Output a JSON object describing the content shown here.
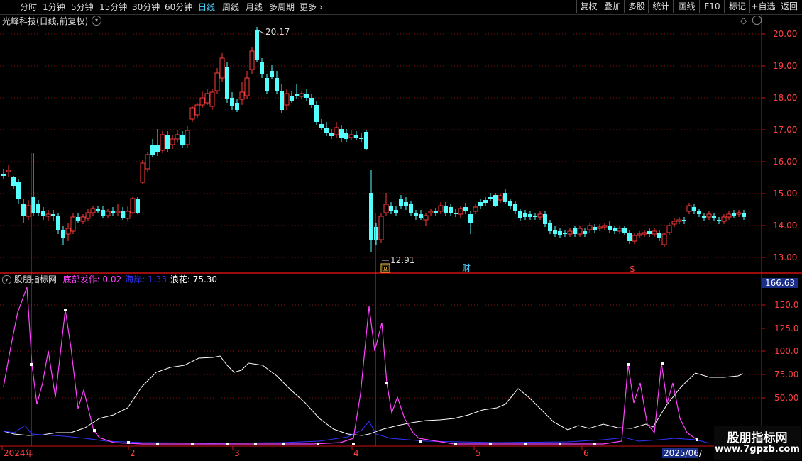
{
  "toolbar": {
    "periods": [
      "分时",
      "1分钟",
      "5分钟",
      "15分钟",
      "30分钟",
      "60分钟",
      "日线",
      "周线",
      "月线",
      "多周期",
      "更多"
    ],
    "active_period": "日线",
    "more_arrow": "›",
    "right_buttons": [
      "复权",
      "叠加",
      "多股",
      "统计",
      "画线",
      "F10",
      "标记",
      "+自选",
      "返回"
    ]
  },
  "chart": {
    "stock_title": "光峰科技(日线,前复权)",
    "price_ticks": [
      "20.00",
      "19.00",
      "18.00",
      "17.00",
      "16.00",
      "15.00",
      "14.00",
      "13.00"
    ],
    "high_label": "20.17",
    "low_label": "12.91",
    "markers": [
      "回",
      "财",
      "$"
    ],
    "up_color": "#ff3c3c",
    "down_color": "#54ffff"
  },
  "indicator": {
    "name": "股朋指标网",
    "series": [
      {
        "label": "底部发作:",
        "value": "0.02",
        "color": "#ff44ff"
      },
      {
        "label": "海岸:",
        "value": "1.33",
        "color": "#3333ff"
      },
      {
        "label": "浪花:",
        "value": "75.30",
        "color": "#ffffff"
      }
    ],
    "current_value": "166.63",
    "ticks": [
      "150.0",
      "125.0",
      "100.0",
      "75.00",
      "50.00"
    ]
  },
  "time_axis": {
    "labels": [
      "2024年",
      "2",
      "3",
      "4",
      "5",
      "6"
    ],
    "end_label": "2025/06/"
  },
  "watermark": {
    "title": "股朋指标网",
    "url": "www.7gpzb.com"
  }
}
